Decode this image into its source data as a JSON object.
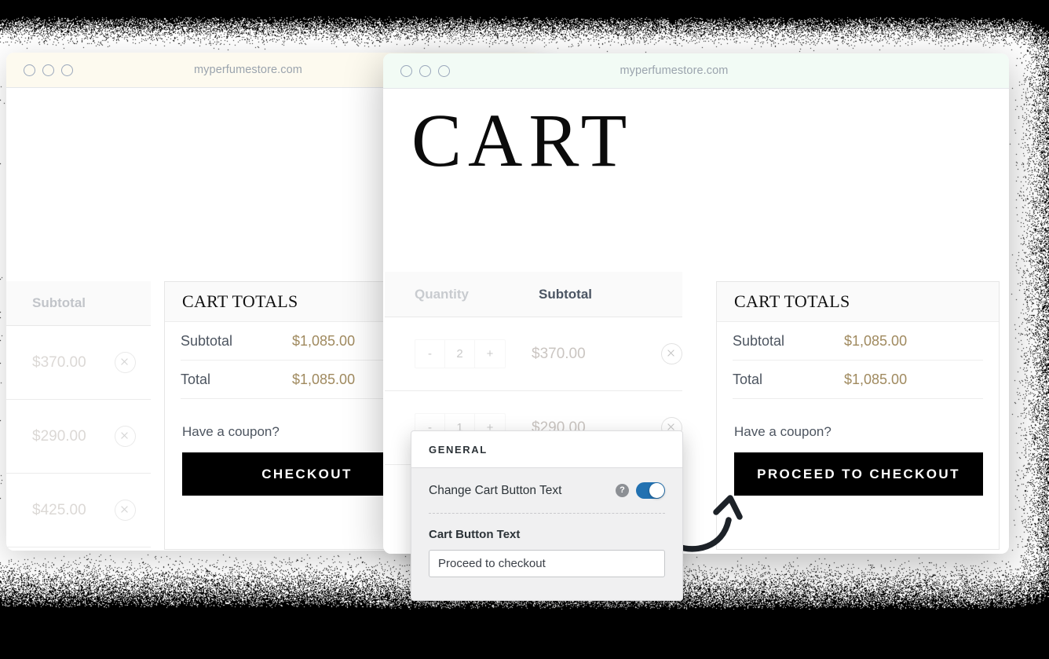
{
  "background": {
    "color": "#000000",
    "page_color": "#ffffff"
  },
  "back_window": {
    "titlebar": {
      "url": "myperfumestore.com",
      "bg": "#fdfaef",
      "dots": [
        "dot",
        "dot",
        "dot"
      ]
    },
    "table": {
      "headers": [
        "Subtotal"
      ],
      "rows": [
        {
          "subtotal": "$370.00",
          "remove": "remove-item"
        },
        {
          "subtotal": "$290.00",
          "remove": "remove-item"
        },
        {
          "subtotal": "$425.00",
          "remove": "remove-item"
        }
      ]
    },
    "totals": {
      "title": "CART TOTALS",
      "lines": [
        {
          "label": "Subtotal",
          "value": "$1,085.00"
        },
        {
          "label": "Total",
          "value": "$1,085.00"
        }
      ],
      "coupon": "Have a coupon?",
      "button": "CHECKOUT"
    }
  },
  "front_window": {
    "titlebar": {
      "url": "myperfumestore.com",
      "bg": "#f2fbf5"
    },
    "heading": "CART",
    "table": {
      "headers": [
        "Quantity",
        "Subtotal"
      ],
      "rows": [
        {
          "minus": "-",
          "qty": "2",
          "plus": "+",
          "subtotal": "$370.00",
          "remove": "remove-item"
        },
        {
          "minus": "-",
          "qty": "1",
          "plus": "+",
          "subtotal": "$290.00",
          "remove": "remove-item"
        }
      ]
    },
    "totals": {
      "title": "CART TOTALS",
      "lines": [
        {
          "label": "Subtotal",
          "value": "$1,085.00"
        },
        {
          "label": "Total",
          "value": "$1,085.00"
        }
      ],
      "coupon": "Have a coupon?",
      "button": "PROCEED TO CHECKOUT"
    }
  },
  "settings_popup": {
    "section_title": "GENERAL",
    "toggle_row": {
      "label": "Change Cart Button Text",
      "help": "?",
      "state": "on",
      "color": "#2271b1"
    },
    "field": {
      "label": "Cart Button Text",
      "value": "Proceed to checkout",
      "placeholder": "Proceed to checkout"
    }
  },
  "annotation": {
    "arrow": "curved-up-arrow"
  },
  "accent": {
    "price": "#a08a5f",
    "toggle_on": "#2271b1",
    "button_bg": "#000000"
  }
}
